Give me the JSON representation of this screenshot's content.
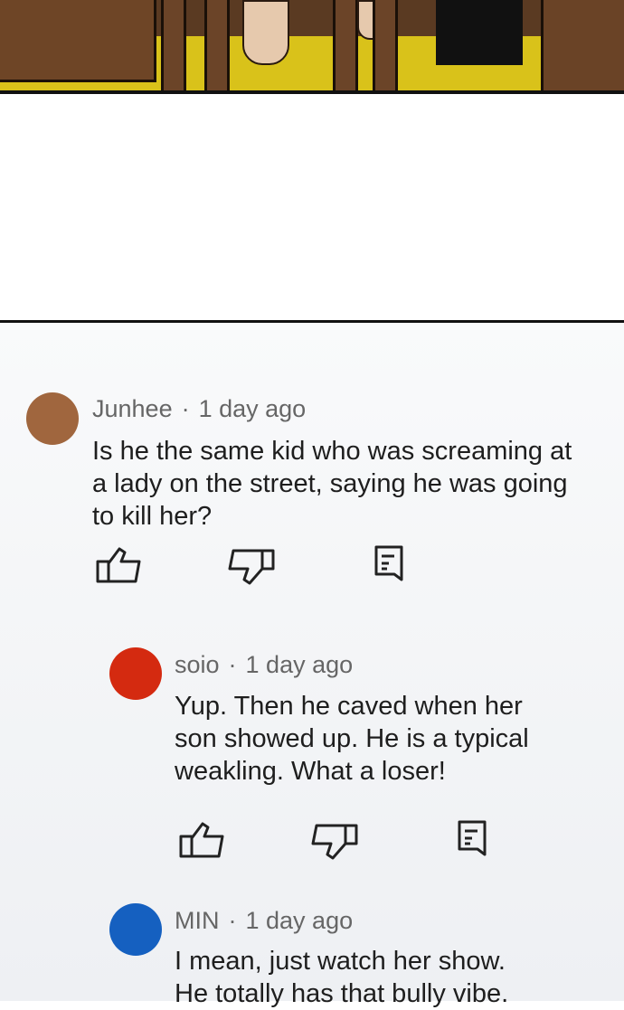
{
  "comments": [
    {
      "author": "Junhee",
      "time": "1 day ago",
      "avatar_color": "#a0663e",
      "lines": [
        "Is he the same kid who was screaming at",
        "a lady on the street, saying he was going",
        "to kill her?"
      ],
      "actions": {
        "like_icon": "thumbs-up-icon",
        "dislike_icon": "thumbs-down-icon",
        "reply_icon": "reply-icon"
      }
    },
    {
      "author": "soio",
      "time": "1 day ago",
      "avatar_color": "#d42a10",
      "lines": [
        "Yup. Then he caved when her",
        "son showed up. He is a typical",
        "weakling. What a loser!"
      ],
      "actions": {
        "like_icon": "thumbs-up-icon",
        "dislike_icon": "thumbs-down-icon",
        "reply_icon": "reply-icon"
      }
    },
    {
      "author": "MIN",
      "time": "1 day ago",
      "avatar_color": "#1560c0",
      "lines": [
        "I mean, just watch her show.",
        "He totally has that bully vibe."
      ]
    }
  ]
}
